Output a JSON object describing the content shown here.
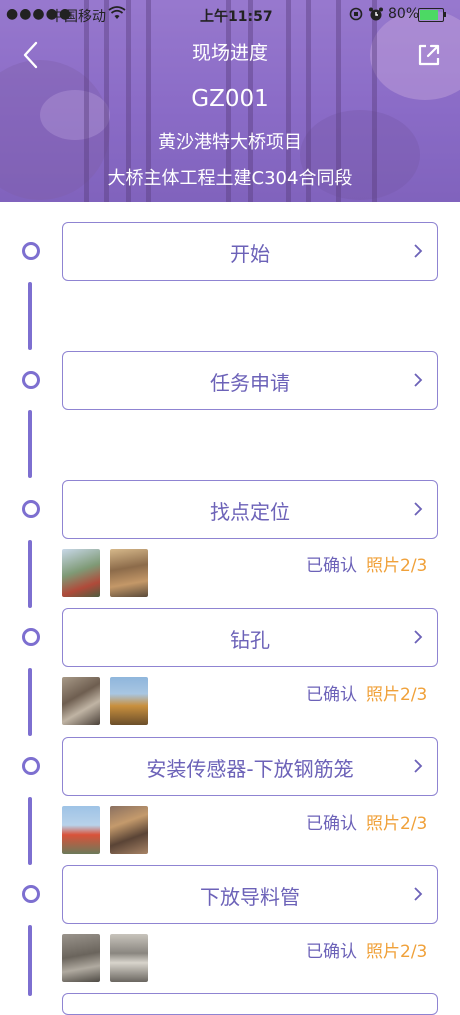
{
  "status_bar": {
    "signal": "●●●●●",
    "carrier": "中国移动",
    "time": "上午11:57",
    "battery_pct": "80%",
    "battery_level": 0.8,
    "icons": [
      "wifi-icon",
      "orientation-lock-icon",
      "alarm-clock-icon",
      "battery-icon"
    ]
  },
  "header": {
    "title": "现场进度",
    "code": "GZ001",
    "project": "黄沙港特大桥项目",
    "section": "大桥主体工程土建C304合同段",
    "icons": [
      "back-arrow-icon",
      "share-icon"
    ]
  },
  "steps": [
    {
      "label": "开始"
    },
    {
      "label": "任务申请"
    },
    {
      "label": "找点定位",
      "status": "已确认",
      "photos": "照片2/3"
    },
    {
      "label": "钻孔",
      "status": "已确认",
      "photos": "照片2/3"
    },
    {
      "label": "安装传感器-下放钢筋笼",
      "status": "已确认",
      "photos": "照片2/3"
    },
    {
      "label": "下放导料管",
      "status": "已确认",
      "photos": "照片2/3"
    }
  ],
  "colors": {
    "accent": "#7d6fd0",
    "text": "#6c62b8",
    "photo_count": "#f0a13a",
    "header": "#8a6cc4"
  }
}
